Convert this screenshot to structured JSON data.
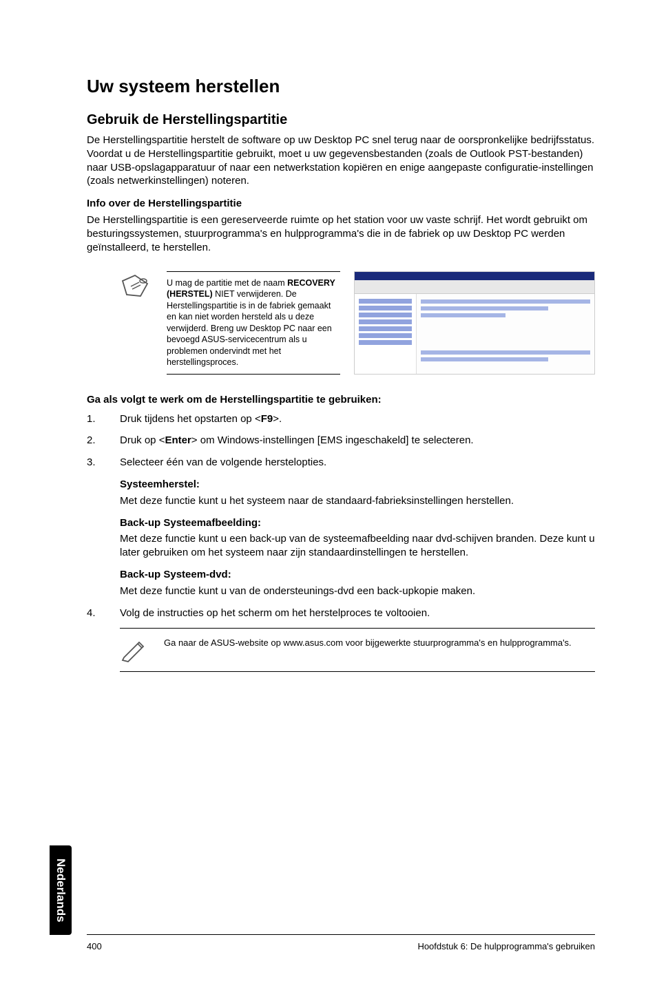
{
  "title": "Uw systeem herstellen",
  "section1": {
    "heading": "Gebruik de Herstellingspartitie",
    "para": "De Herstellingspartitie herstelt de software op uw Desktop PC snel terug naar de oorspronkelijke bedrijfsstatus. Voordat u de Herstellingspartitie gebruikt, moet u uw gegevensbestanden (zoals de Outlook PST-bestanden) naar USB-opslagapparatuur of naar een netwerkstation kopiëren en enige aangepaste configuratie-instellingen (zoals netwerkinstellingen) noteren."
  },
  "section2": {
    "heading": "Info over de Herstellingspartitie",
    "para": "De Herstellingspartitie is een gereserveerde ruimte op het station voor uw vaste schrijf. Het wordt gebruikt om besturingssystemen, stuurprogramma's en hulpprogramma's die in de fabriek op uw Desktop PC werden geïnstalleerd, te herstellen."
  },
  "note1": {
    "pre": "U mag de partitie met de naam ",
    "bold": "RECOVERY (HERSTEL)",
    "post": " NIET verwijderen. De Herstellingspartitie is in de fabriek gemaakt en kan niet worden hersteld als u deze verwijderd. Breng uw Desktop PC naar een bevoegd ASUS-servicecentrum als u problemen ondervindt met het herstellingsproces."
  },
  "steps_heading": "Ga als volgt te werk om de Herstellingspartitie te gebruiken:",
  "steps": {
    "s1_num": "1.",
    "s1_pre": "Druk tijdens het opstarten op <",
    "s1_key": "F9",
    "s1_post": ">.",
    "s2_num": "2.",
    "s2_pre": "Druk op <",
    "s2_key": "Enter",
    "s2_post": "> om Windows-instellingen [EMS ingeschakeld] te selecteren.",
    "s3_num": "3.",
    "s3_text": "Selecteer één van de volgende herstelopties.",
    "s4_num": "4.",
    "s4_text": "Volg de instructies op het scherm om het herstelproces te voltooien."
  },
  "options": {
    "opt1_h": "Systeemherstel:",
    "opt1_p": "Met deze functie kunt u het systeem naar de standaard-fabrieksinstellingen herstellen.",
    "opt2_h": "Back-up Systeemafbeelding:",
    "opt2_p": "Met deze functie kunt u een back-up van de systeemafbeelding naar dvd-schijven branden. Deze kunt u later gebruiken om het systeem naar zijn standaardinstellingen te herstellen.",
    "opt3_h": "Back-up Systeem-dvd:",
    "opt3_p": "Met deze functie kunt u van de ondersteunings-dvd een back-upkopie maken."
  },
  "note2": "Ga naar de ASUS-website op www.asus.com voor bijgewerkte stuurprogramma's en hulpprogramma's.",
  "sidetab": "Nederlands",
  "footer": {
    "left": "400",
    "right": "Hoofdstuk 6: De hulpprogramma's gebruiken"
  }
}
